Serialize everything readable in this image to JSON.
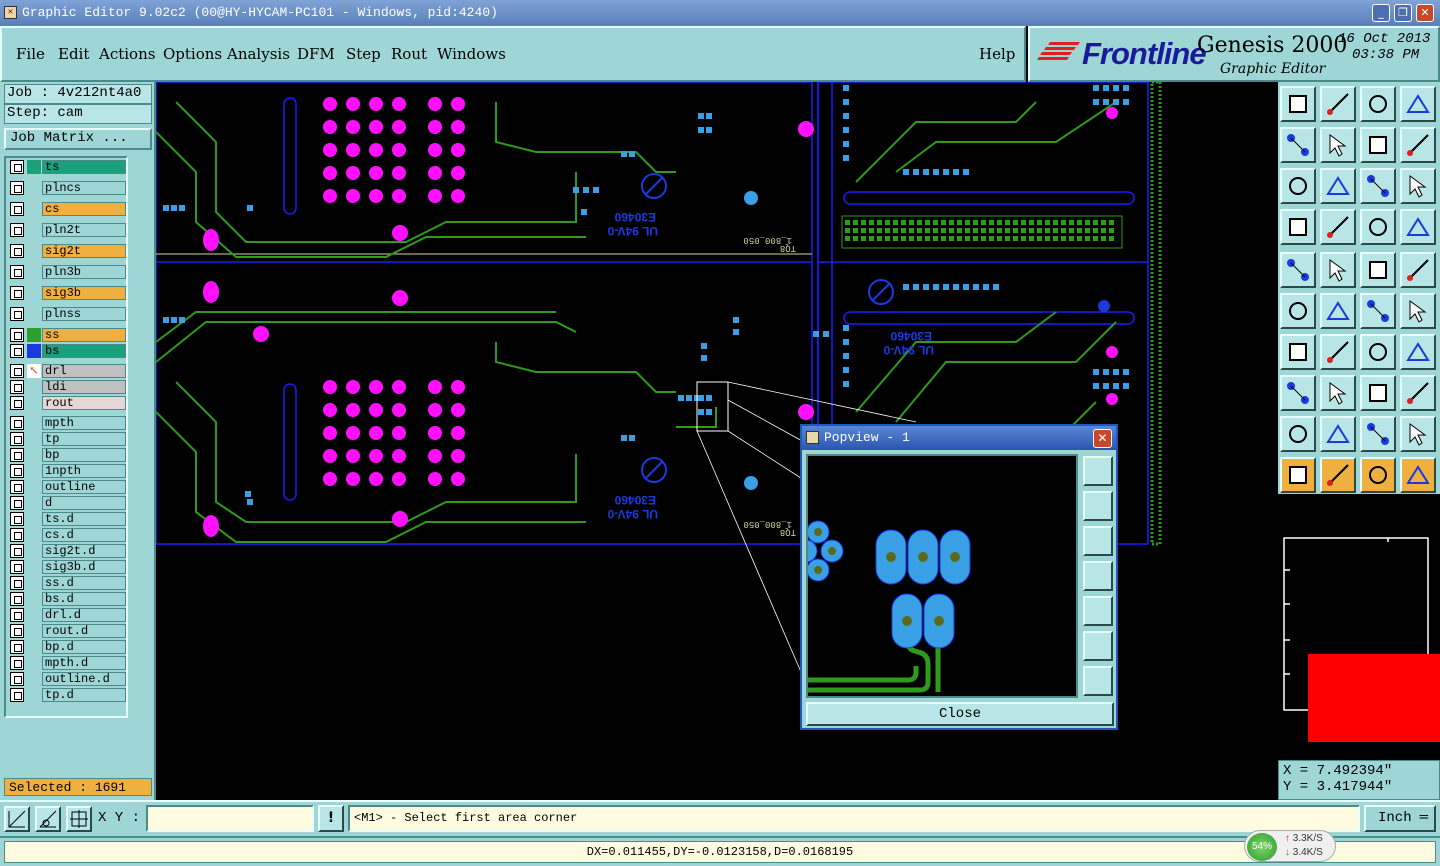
{
  "window": {
    "title": "Graphic Editor 9.02c2 (00@HY-HYCAM-PC101 - Windows, pid:4240)",
    "minimize": "_",
    "restore": "❐",
    "close": "✕"
  },
  "menu": {
    "items": [
      {
        "label": "File"
      },
      {
        "label": "Edit"
      },
      {
        "label": "Actions"
      },
      {
        "label": "Options"
      },
      {
        "label": "Analysis"
      },
      {
        "label": "DFM"
      },
      {
        "label": "Step"
      },
      {
        "label": "Rout"
      },
      {
        "label": "Windows"
      }
    ],
    "help": "Help"
  },
  "logo": {
    "brand": "Frontline",
    "product": "Genesis 2000",
    "subtitle": "Graphic Editor",
    "date": "16 Oct 2013",
    "time": "03:38 PM"
  },
  "job": {
    "job_line": "Job : 4v212nt4a0",
    "step_line": "Step: cam",
    "matrix_button": "Job Matrix ..."
  },
  "layers": [
    {
      "name": "ts",
      "color": "#1aa07a",
      "fill": "#1aa07a"
    },
    {
      "name": "plncs",
      "color": "",
      "fill": "#9ed6d6"
    },
    {
      "name": "cs",
      "color": "",
      "fill": "#f0b040"
    },
    {
      "name": "pln2t",
      "color": "",
      "fill": "#9ed6d6"
    },
    {
      "name": "sig2t",
      "color": "",
      "fill": "#f0b040"
    },
    {
      "name": "pln3b",
      "color": "",
      "fill": "#9ed6d6"
    },
    {
      "name": "sig3b",
      "color": "",
      "fill": "#f0b040"
    },
    {
      "name": "plnss",
      "color": "",
      "fill": "#9ed6d6"
    },
    {
      "name": "ss",
      "color": "#2ca02c",
      "fill": "#f0b040"
    },
    {
      "name": "bs",
      "color": "#1a3ae0",
      "fill": "#1aa07a"
    },
    {
      "name": "drl",
      "color": "#e02020",
      "fill": "#c0c0c0"
    },
    {
      "name": "ldi",
      "color": "",
      "fill": "#c0c0c0"
    },
    {
      "name": "rout",
      "color": "",
      "fill": "#e6d6d6"
    },
    {
      "name": "mpth",
      "color": "",
      "fill": "#9ed6d6"
    },
    {
      "name": "tp",
      "color": "",
      "fill": "#9ed6d6"
    },
    {
      "name": "bp",
      "color": "",
      "fill": "#9ed6d6"
    },
    {
      "name": "1npth",
      "color": "",
      "fill": "#9ed6d6"
    },
    {
      "name": "outline",
      "color": "",
      "fill": "#9ed6d6"
    },
    {
      "name": "d",
      "color": "",
      "fill": "#9ed6d6"
    },
    {
      "name": "ts.d",
      "color": "",
      "fill": "#9ed6d6"
    },
    {
      "name": "cs.d",
      "color": "",
      "fill": "#9ed6d6"
    },
    {
      "name": "sig2t.d",
      "color": "",
      "fill": "#9ed6d6"
    },
    {
      "name": "sig3b.d",
      "color": "",
      "fill": "#9ed6d6"
    },
    {
      "name": "ss.d",
      "color": "",
      "fill": "#9ed6d6"
    },
    {
      "name": "bs.d",
      "color": "",
      "fill": "#9ed6d6"
    },
    {
      "name": "drl.d",
      "color": "",
      "fill": "#9ed6d6"
    },
    {
      "name": "rout.d",
      "color": "",
      "fill": "#9ed6d6"
    },
    {
      "name": "bp.d",
      "color": "",
      "fill": "#9ed6d6"
    },
    {
      "name": "mpth.d",
      "color": "",
      "fill": "#9ed6d6"
    },
    {
      "name": "outline.d",
      "color": "",
      "fill": "#9ed6d6"
    },
    {
      "name": "tp.d",
      "color": "",
      "fill": "#9ed6d6"
    }
  ],
  "selected": "Selected : 1691",
  "coords": {
    "x": "X = 7.492394\"",
    "y": "Y = 3.417944\""
  },
  "bottom": {
    "xy_label": "X Y :",
    "xy_value": "",
    "bang": "!",
    "prompt": "<M1> - Select first area corner",
    "units": "Inch"
  },
  "status": "DX=0.011455,DY=-0.0123158,D=0.0168195",
  "netmon": {
    "percent": "54%",
    "up": "3.3K/S",
    "down": "3.4K/S"
  },
  "popview": {
    "title": "Popview - 1",
    "close_label": "Close"
  },
  "board_text": {
    "label_a": "E30460",
    "label_b": "UL 94V-0",
    "label_c": "1_800_050",
    "label_d": "TQ8"
  },
  "colors": {
    "panel": "#9ed6d6",
    "copper_green": "#2f9a1c",
    "pad_blue": "#3aa0e6",
    "drill_magenta": "#ff10ff",
    "outline_blue": "#1a1aff"
  }
}
